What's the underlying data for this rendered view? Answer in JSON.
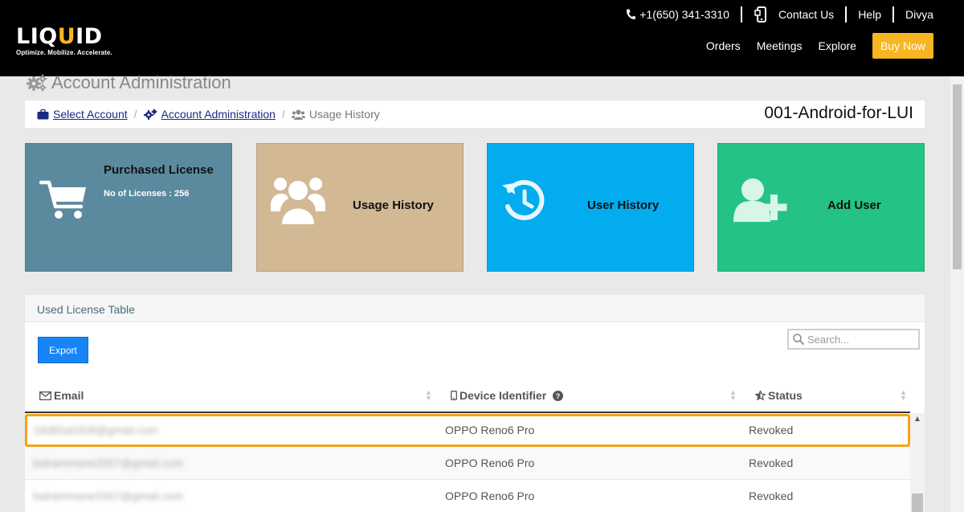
{
  "header": {
    "logo": {
      "text_prefix": "LIQ",
      "text_accent": "U",
      "text_suffix": "ID",
      "tagline": "Optimize. Mobilize. Accelerate."
    },
    "top_links": {
      "phone": "+1(650) 341-3310",
      "contact": "Contact Us",
      "help": "Help",
      "user": "Divya"
    },
    "nav": {
      "orders": "Orders",
      "meetings": "Meetings",
      "explore": "Explore",
      "buy_now": "Buy Now"
    }
  },
  "page": {
    "title": "Account Administration"
  },
  "breadcrumb": {
    "select_account": "Select Account",
    "account_admin": "Account Administration",
    "current": "Usage History",
    "account_name": "001-Android-for-LUI"
  },
  "tiles": {
    "purchased": {
      "title": "Purchased License",
      "sub": "No of Licenses : 256"
    },
    "usage": {
      "title": "Usage History"
    },
    "user_history": {
      "title": "User History"
    },
    "add_user": {
      "title": "Add User"
    }
  },
  "table": {
    "panel_title": "Used License Table",
    "export_label": "Export",
    "search_placeholder": "Search...",
    "columns": {
      "email": "Email",
      "device": "Device Identifier",
      "status": "Status"
    },
    "rows": [
      {
        "email": "18d85a0308@gmail.com",
        "device": "OPPO Reno6 Pro",
        "status": "Revoked"
      },
      {
        "email": "balrammane3307@gmail.com",
        "device": "OPPO Reno6 Pro",
        "status": "Revoked"
      },
      {
        "email": "balrammane3307@gmail.com",
        "device": "OPPO Reno6 Pro",
        "status": "Revoked"
      }
    ]
  },
  "colors": {
    "header_bg": "#000000",
    "accent": "#f7b521",
    "tile_purchased": "#5b8a9e",
    "tile_usage": "#d2b994",
    "tile_user_history": "#03acef",
    "tile_add_user": "#24c385",
    "export_btn": "#1784f7",
    "selected_row_border": "#f5a21b"
  },
  "icons": [
    "phone-icon",
    "mobile-icon",
    "gears-icon",
    "briefcase-icon",
    "users-icon",
    "cart-icon",
    "history-icon",
    "add-user-icon",
    "envelope-icon",
    "help-icon",
    "star-half-icon",
    "search-icon"
  ]
}
